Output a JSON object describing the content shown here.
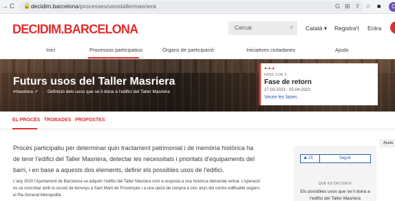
{
  "browser": {
    "back": "→",
    "reload": "C",
    "domain": "decidim.barcelona",
    "path": "/processes/usostallermasriera",
    "icons": [
      "google-icon",
      "translate-icon",
      "share-icon",
      "star-icon",
      "sidebar-icon"
    ],
    "profile_initial": "C"
  },
  "header": {
    "logo": "DECIDIM.BARCELONA",
    "search_placeholder": "Cercar",
    "language": "Català ▾",
    "register": "Registra't",
    "login": "Entra"
  },
  "mainnav": {
    "items": [
      "Inici",
      "Processos participatius",
      "Òrgans de participació",
      "Iniciatives ciutadanes",
      "Ajuda"
    ],
    "active_index": 1
  },
  "hero": {
    "title": "Futurs usos del Taller Masriera",
    "hashtag": "#masriera ↗",
    "separator": "·",
    "subtitle": "Definició dels usos que se li dona a l'edifici del Taller Masriera"
  },
  "phase": {
    "dots": "●-●-●",
    "count": "FASE 3 DE 3",
    "name": "Fase de retorn",
    "dates": "27-03-2023 - 03-04-2023",
    "link": "Veure les fases"
  },
  "tabs": [
    "EL PROCÉS",
    "TROBADES",
    "PROPOSTES"
  ],
  "content": {
    "lead": "Procés participatiu per determinar quin tractament patrimonial i de memòria històrica ha de tenir l'edifici del Taller Masriera, detectar les necessitats i prioritats d'equipaments del barri, i en base a aquests dos elements, definir els possibles usos de l'edifici.",
    "body": "L'any 2020 l'Ajuntament de Barcelona va adquirir l'edifici del Taller Masriera com a resposta a una històrica demanda veïnal. L'operació es va concretar amb la cessió de terrenys a Sant Martí de Provençals i a una opció de compra a cinc anys del centre edificable segons el Pla General Metropolità."
  },
  "sidebar": {
    "follow_count": "25",
    "follow_label": "Seguir",
    "decide_label": "QUÈ ES DECIDEIX",
    "decide_text": "Els possibles usos que se li dona a l'edifici del Taller Masriera"
  },
  "help": "Ajuda",
  "colors": {
    "brand": "#e02d2d",
    "link": "#2a5db0"
  }
}
